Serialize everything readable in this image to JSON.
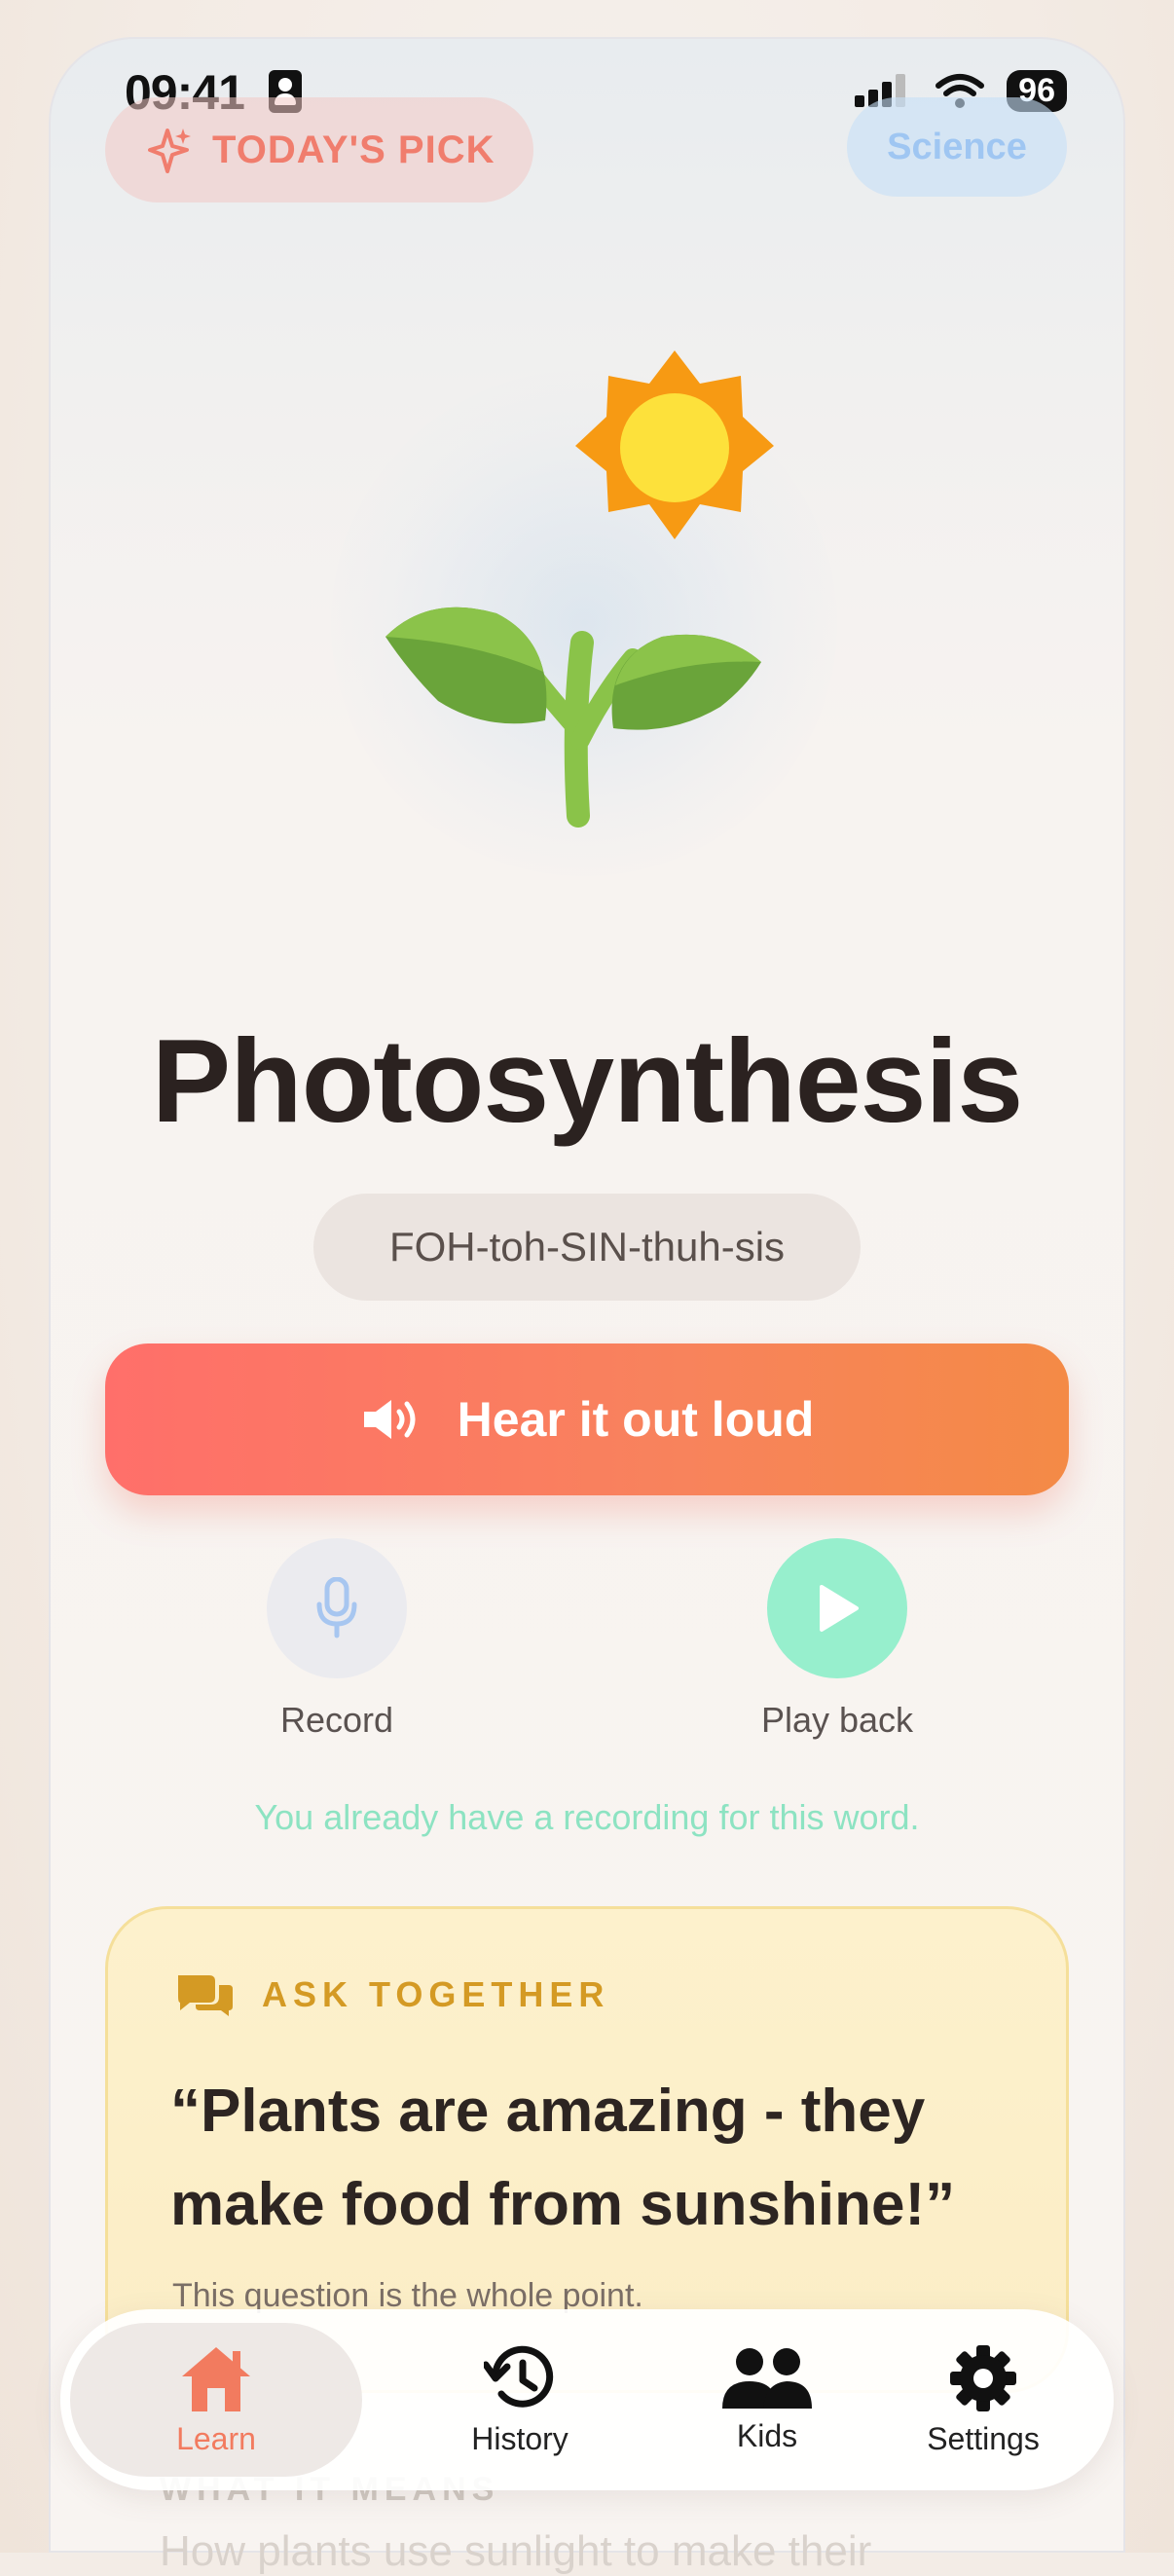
{
  "status_bar": {
    "time": "09:41",
    "battery": "96"
  },
  "header": {
    "pick_label": "TODAY'S PICK",
    "category": "Science"
  },
  "word": {
    "title": "Photosynthesis",
    "pronunciation": "FOH-toh-SIN-thuh-sis"
  },
  "actions": {
    "hear_label": "Hear it out loud",
    "record_label": "Record",
    "playback_label": "Play back",
    "recording_note": "You already have a recording for this word."
  },
  "ask_card": {
    "label": "ASK TOGETHER",
    "quote": "“Plants are amazing - they make food from sunshine!”",
    "note": "This question is the whole point."
  },
  "below": {
    "section_label": "WHAT IT MEANS",
    "definition_start": "How plants use sunlight to make their"
  },
  "tabs": [
    {
      "label": "Learn",
      "icon": "home-icon",
      "active": true
    },
    {
      "label": "History",
      "icon": "history-icon",
      "active": false
    },
    {
      "label": "Kids",
      "icon": "kids-icon",
      "active": false
    },
    {
      "label": "Settings",
      "icon": "gear-icon",
      "active": false
    }
  ],
  "colors": {
    "accent": "#f27b5f",
    "hear_gradient_start": "#ff6f6a",
    "hear_gradient_end": "#f48a46",
    "playback": "#97efcd",
    "ask_accent": "#d49a24"
  }
}
